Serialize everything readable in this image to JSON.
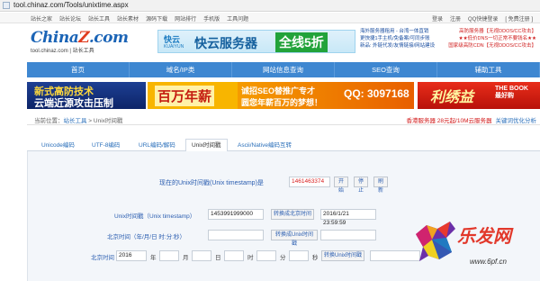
{
  "browser": {
    "url": "tool.chinaz.com/Tools/unixtime.aspx"
  },
  "topnav": {
    "links": [
      "站长之家",
      "站长论坛",
      "站长工具",
      "站长素材",
      "源码下载",
      "网站排行",
      "手机版",
      "工具问题"
    ],
    "right": [
      "登录",
      "注册",
      "QQ快捷登录",
      "[ 免费注册 ]"
    ]
  },
  "header": {
    "logo_main": "China",
    "logo_z": "Z",
    "logo_end": ".com",
    "logo_sub": "tool.chinaz.com | 站长工具",
    "banner_brand": "快云",
    "banner_brand_sub": "KUAIYUN",
    "banner_title": "快云服务器",
    "banner_highlight": "全线5折",
    "ads_right": [
      [
        "海外服务器租用 - 台湾一体直销",
        "高防服务器【无视DDOS/CC攻击】"
      ],
      [
        "更快捷1手主机/免备案/可同步账",
        "★★低价DNS一切正常不要钱名★★"
      ],
      [
        "新品: 外链代发/友情链接/网站建设",
        "国家级高防CDN【无视DDOS/CC攻击】"
      ]
    ]
  },
  "mainnav": [
    "首页",
    "域名/IP类",
    "网站信息查询",
    "SEO查询",
    "辅助工具"
  ],
  "ads": {
    "ad1_line1": "新式高防技术",
    "ad1_line2": "云端近源攻击压制",
    "ad2_text": "百万年薪",
    "ad3_line1": "诚招SEO替推广专才",
    "ad3_line2": "圆您年薪百万的梦想！",
    "ad3_qq": "QQ: 3097168",
    "ad4_text": "利绣益",
    "ad4_sub": "THE BOOK 最好购"
  },
  "breadcrumb": {
    "prefix": "当前位置：",
    "site": "站长工具",
    "sep": " > ",
    "page": "Unix时间戳",
    "promo_red": "香港服务器 28元起/10M云服务器",
    "promo_blue": "关键词优化分析"
  },
  "tabs": [
    "Unicode编码",
    "UTF-8编码",
    "URL编码/解码",
    "Unix时间戳",
    "Ascii/Native编码互转"
  ],
  "form": {
    "now_label": "现在的Unix时间戳(Unix timestamp)是",
    "now_value": "1461463374",
    "btn_start": "开始",
    "btn_stop": "停止",
    "btn_refresh": "刷新",
    "ts_label": "Unix时间戳（Unix timestamp）",
    "ts_value": "1453991999000",
    "btn_to_beijing": "转换成北京时间",
    "ts_result": "2016/1/21 23:59:59",
    "bj_label": "北京时间（年/月/日 时:分:秒）",
    "btn_to_unix": "转换成Unix时间戳",
    "bj2_label": "北京时间",
    "year_value": "2016",
    "unit_year": "年",
    "unit_month": "月",
    "unit_day": "日",
    "unit_hour": "时",
    "unit_min": "分",
    "unit_sec": "秒",
    "btn_to_unix2": "转换Unix时间戳"
  },
  "watermark": {
    "text": "乐发网",
    "url": "www.6pf.cn"
  }
}
